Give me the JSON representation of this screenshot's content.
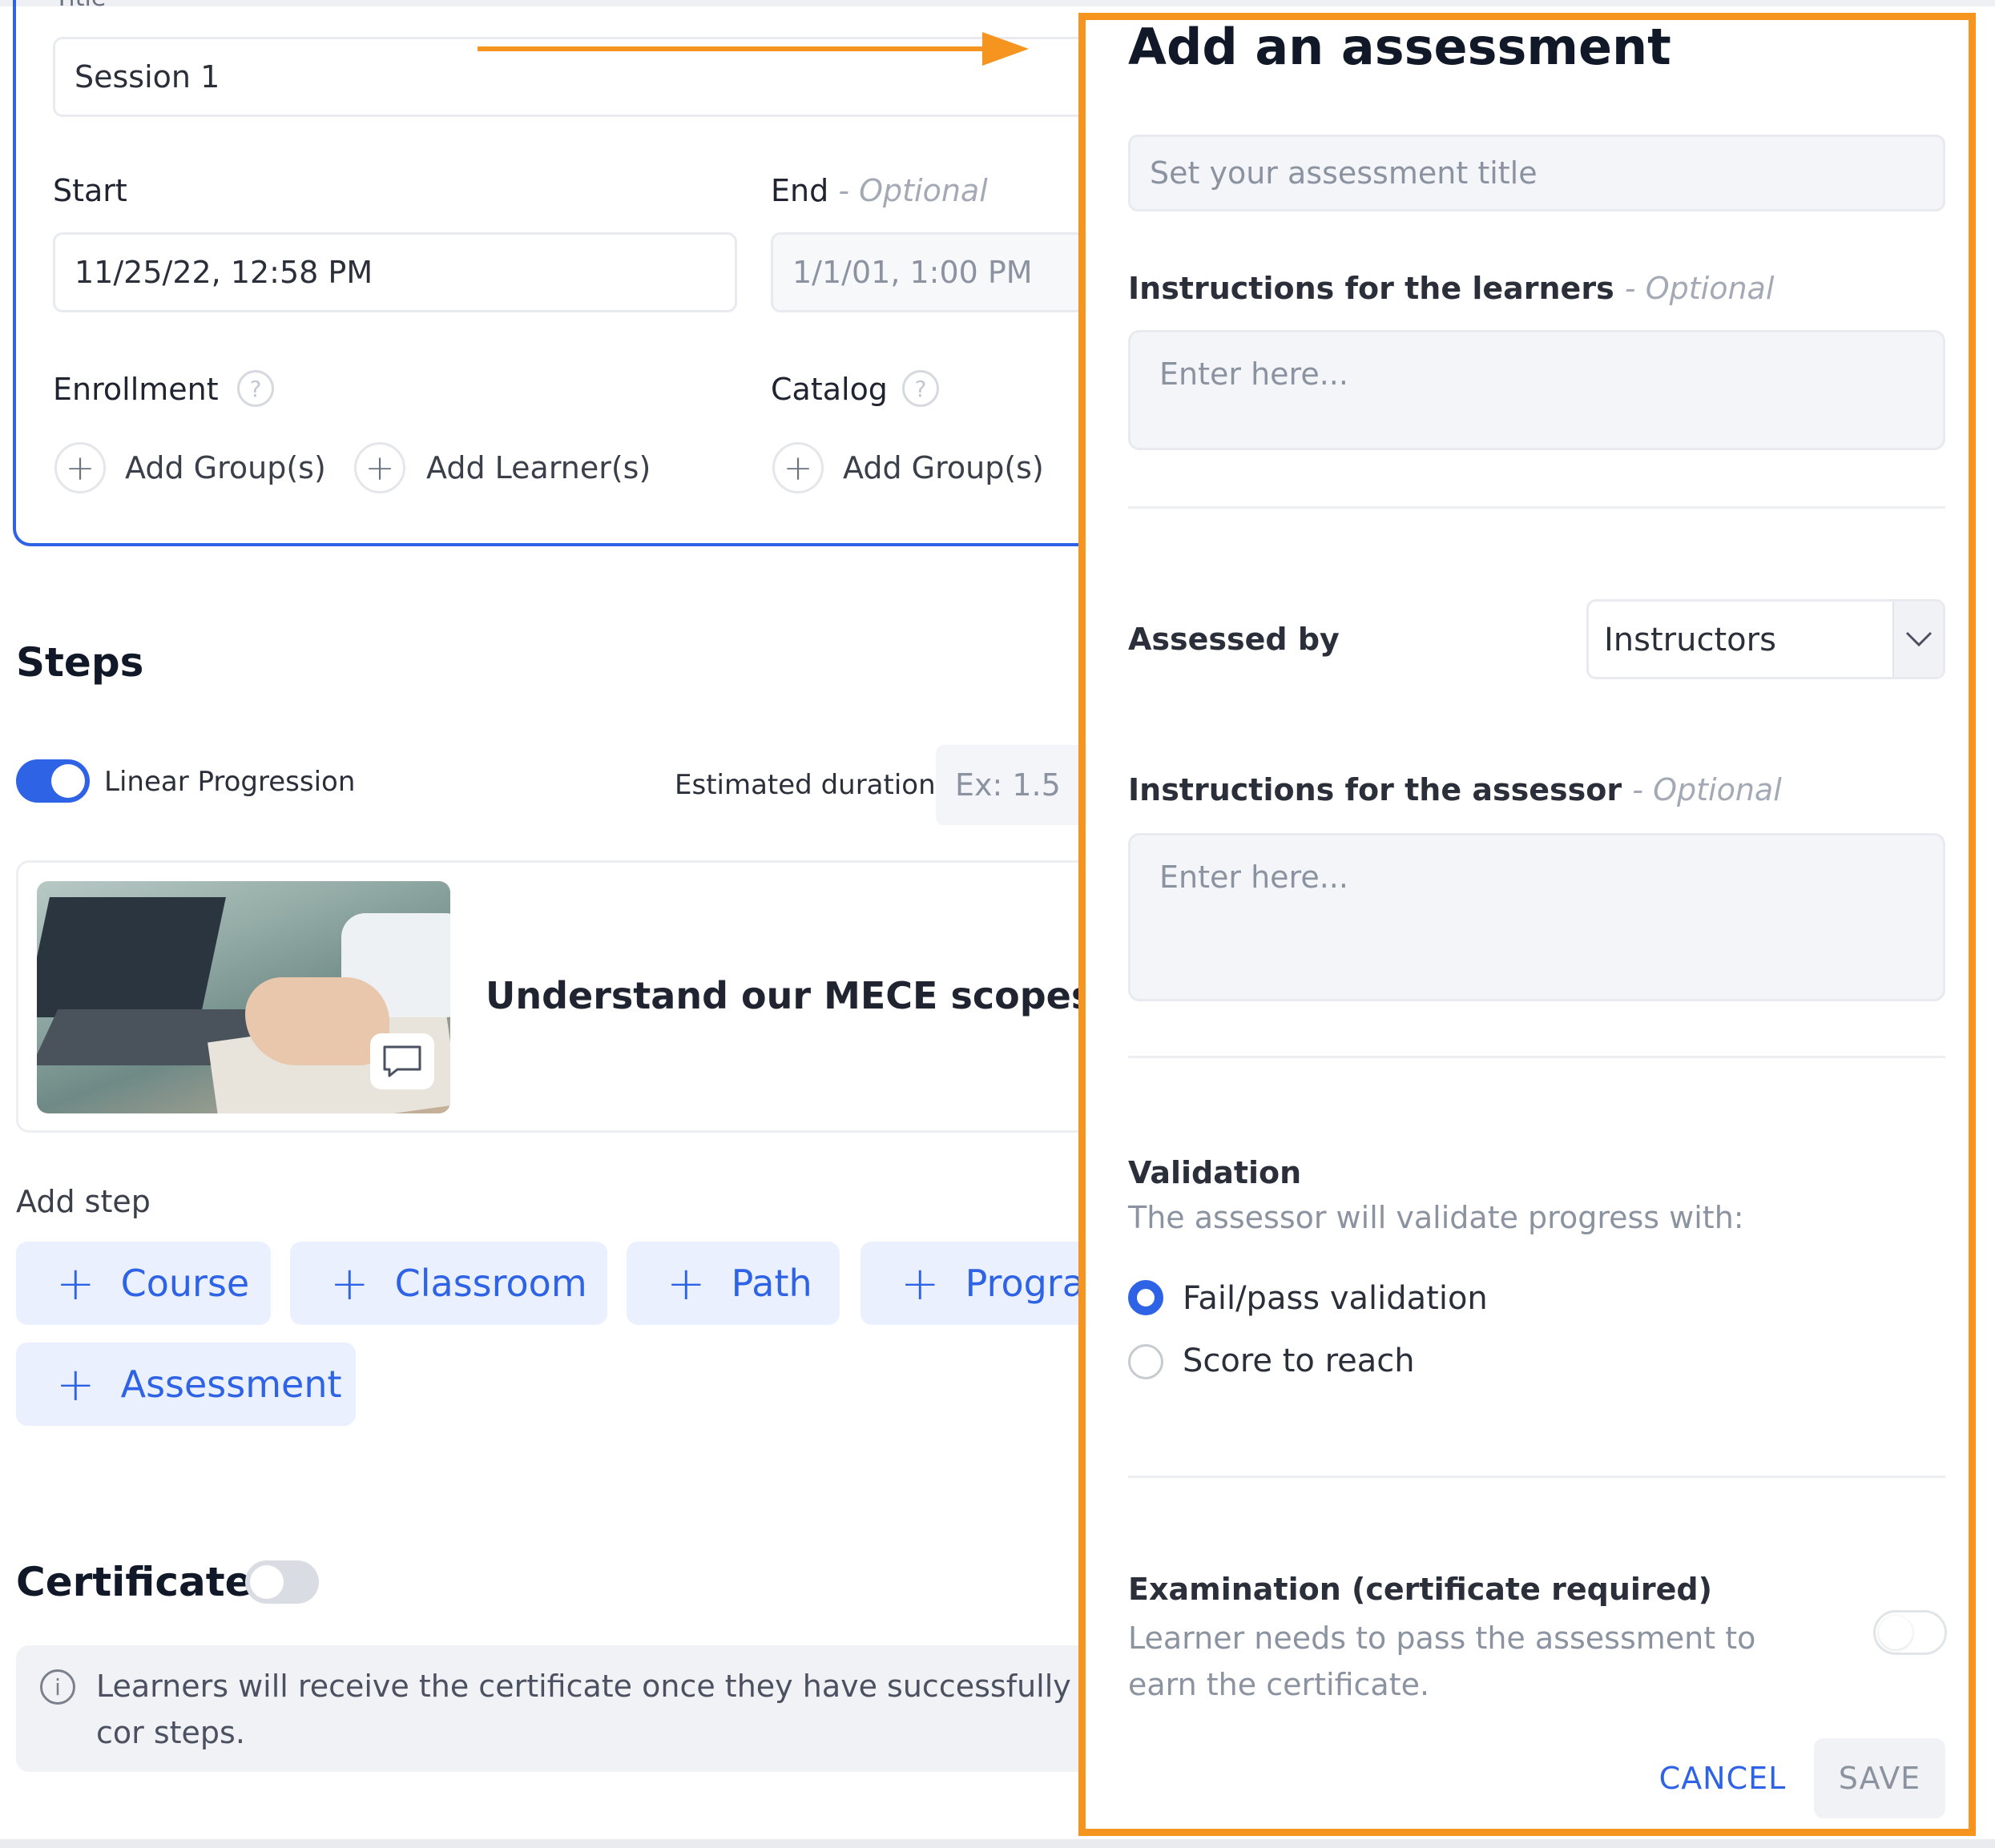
{
  "session": {
    "title_field_label": "Title",
    "title_value": "Session 1",
    "start_label": "Start",
    "start_value": "11/25/22, 12:58 PM",
    "end_label": "End",
    "end_optional": "- Optional",
    "end_value": "1/1/01, 1:00 PM",
    "enrollment_label": "Enrollment",
    "catalog_label": "Catalog",
    "add_groups_label": "Add Group(s)",
    "add_learners_label": "Add Learner(s)",
    "catalog_add_groups_label": "Add Group(s)"
  },
  "steps": {
    "heading": "Steps",
    "linear_progression_label": "Linear Progression",
    "estimated_duration_label": "Estimated duration",
    "estimated_duration_placeholder": "Ex: 1.5",
    "step_title": "Understand our MECE scopes",
    "add_step_label": "Add step",
    "buttons": [
      "Course",
      "Classroom",
      "Path",
      "Progra",
      "Assessment"
    ]
  },
  "certificate": {
    "heading": "Certificate",
    "enabled": false,
    "info_text": "Learners will receive the certificate once they have successfully cor steps."
  },
  "modal": {
    "title": "Add an assessment",
    "title_placeholder": "Set your assessment title",
    "learner_instructions_label": "Instructions for the learners",
    "optional": "- Optional",
    "learner_instructions_placeholder": "Enter here...",
    "assessed_by_label": "Assessed by",
    "assessed_by_value": "Instructors",
    "assessor_instructions_label": "Instructions for the assessor",
    "assessor_instructions_placeholder": "Enter here...",
    "validation_label": "Validation",
    "validation_sub": "The assessor will validate progress with:",
    "option_fail_pass": "Fail/pass validation",
    "option_score": "Score to reach",
    "selected_option": "Fail/pass validation",
    "examination_label": "Examination (certificate required)",
    "examination_text": "Learner needs to pass the assessment to earn the certificate.",
    "examination_enabled": false,
    "cancel_label": "CANCEL",
    "save_label": "SAVE"
  },
  "colors": {
    "accent": "#2e63e6",
    "highlight": "#f5941e",
    "button_bg": "#eaf0fd"
  }
}
